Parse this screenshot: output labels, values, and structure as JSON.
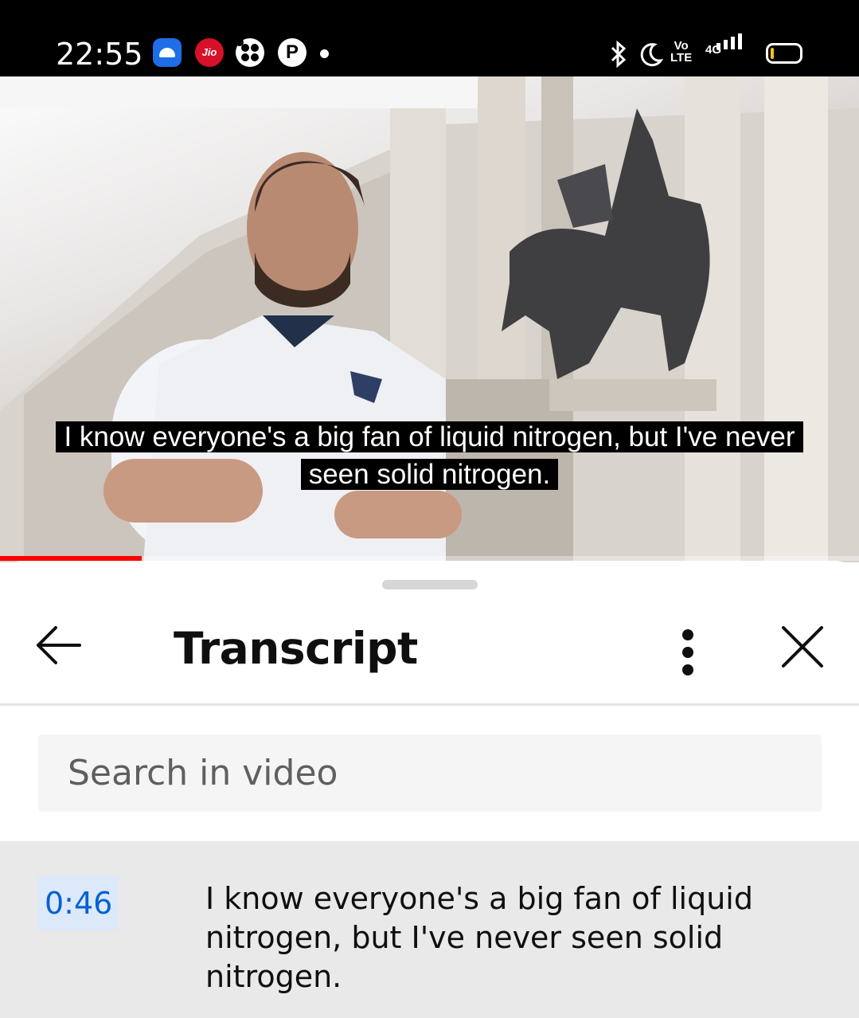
{
  "status_bar": {
    "time": "22:55",
    "jio_label": "Jio",
    "pinterest_label": "P",
    "volte_label": "Vo\nLTE",
    "network_label": "4G"
  },
  "video": {
    "caption_line_1": "I know everyone's a big fan of liquid nitrogen, but I've never",
    "caption_line_2": "seen solid nitrogen.",
    "progress_fraction": 0.165,
    "progress_color": "#ff0000"
  },
  "transcript": {
    "title": "Transcript",
    "search_placeholder": "Search in video",
    "segments": [
      {
        "timestamp": "0:46",
        "text": "I know everyone's a big fan of liquid nitrogen, but I've never seen solid nitrogen."
      }
    ]
  },
  "colors": {
    "accent_link": "#065fd4",
    "highlight_bg": "#e9e9e9",
    "timestamp_bg": "#dbe9fa"
  },
  "icons": {
    "back": "arrow-left-icon",
    "more": "more-vertical-icon",
    "close": "close-icon"
  }
}
